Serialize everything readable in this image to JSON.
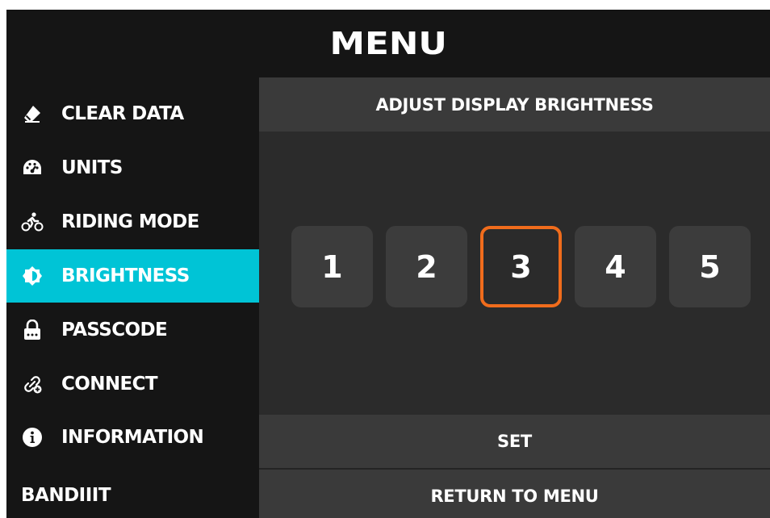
{
  "header": {
    "title": "MENU"
  },
  "sidebar": {
    "items": [
      {
        "label": "CLEAR DATA",
        "icon": "eraser-icon"
      },
      {
        "label": "UNITS",
        "icon": "speedometer-icon"
      },
      {
        "label": "RIDING MODE",
        "icon": "cyclist-icon"
      },
      {
        "label": "BRIGHTNESS",
        "icon": "brightness-icon",
        "active": true
      },
      {
        "label": "PASSCODE",
        "icon": "lock-icon"
      },
      {
        "label": "CONNECT",
        "icon": "link-plus-icon"
      },
      {
        "label": "INFORMATION",
        "icon": "info-icon"
      }
    ],
    "brand": "BANDIIIT"
  },
  "panel": {
    "title": "ADJUST DISPLAY BRIGHTNESS",
    "levels": [
      "1",
      "2",
      "3",
      "4",
      "5"
    ],
    "selected_level": "3",
    "set_label": "SET",
    "return_label": "RETURN TO MENU"
  },
  "colors": {
    "accent": "#00c4d6",
    "selection": "#f06c1c",
    "background": "#141414",
    "panel": "#2b2b2b"
  }
}
